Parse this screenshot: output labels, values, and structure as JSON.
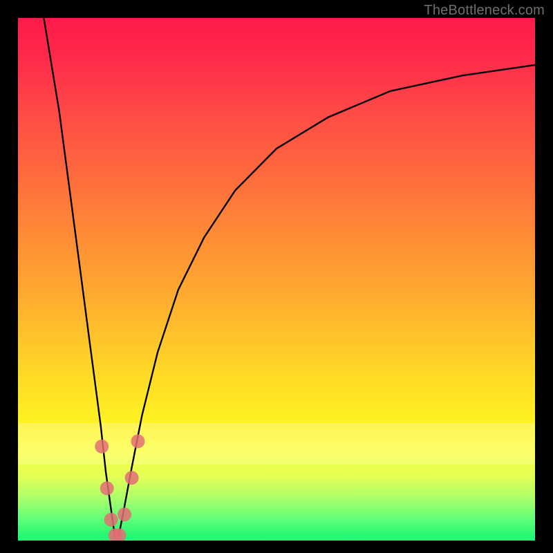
{
  "attribution": "TheBottleneck.com",
  "colors": {
    "gradient_top": "#ff1a4a",
    "gradient_mid": "#ffd328",
    "gradient_bottom": "#14f56e",
    "curve": "#000000",
    "dots": "#e26f74",
    "background": "#000000"
  },
  "chart_data": {
    "type": "line",
    "title": "",
    "xlabel": "",
    "ylabel": "",
    "xlim": [
      0,
      100
    ],
    "ylim": [
      0,
      100
    ],
    "series": [
      {
        "name": "bottleneck-curve",
        "x": [
          5,
          8,
          10,
          12,
          14,
          16,
          17,
          18,
          18.7,
          19.5,
          20.5,
          22,
          24,
          27,
          31,
          36,
          42,
          50,
          60,
          72,
          86,
          100
        ],
        "y": [
          100,
          82,
          67,
          52,
          37,
          22,
          13,
          6,
          1,
          1,
          6,
          14,
          24,
          36,
          48,
          58,
          67,
          75,
          81,
          86,
          89,
          91
        ]
      }
    ],
    "markers": {
      "name": "highlight-dots",
      "color": "#e26f74",
      "points": [
        {
          "x": 16.2,
          "y": 18
        },
        {
          "x": 17.2,
          "y": 10
        },
        {
          "x": 18.0,
          "y": 4
        },
        {
          "x": 18.8,
          "y": 1
        },
        {
          "x": 19.6,
          "y": 1
        },
        {
          "x": 20.6,
          "y": 5
        },
        {
          "x": 22.0,
          "y": 12
        },
        {
          "x": 23.2,
          "y": 19
        }
      ]
    },
    "annotations": []
  }
}
